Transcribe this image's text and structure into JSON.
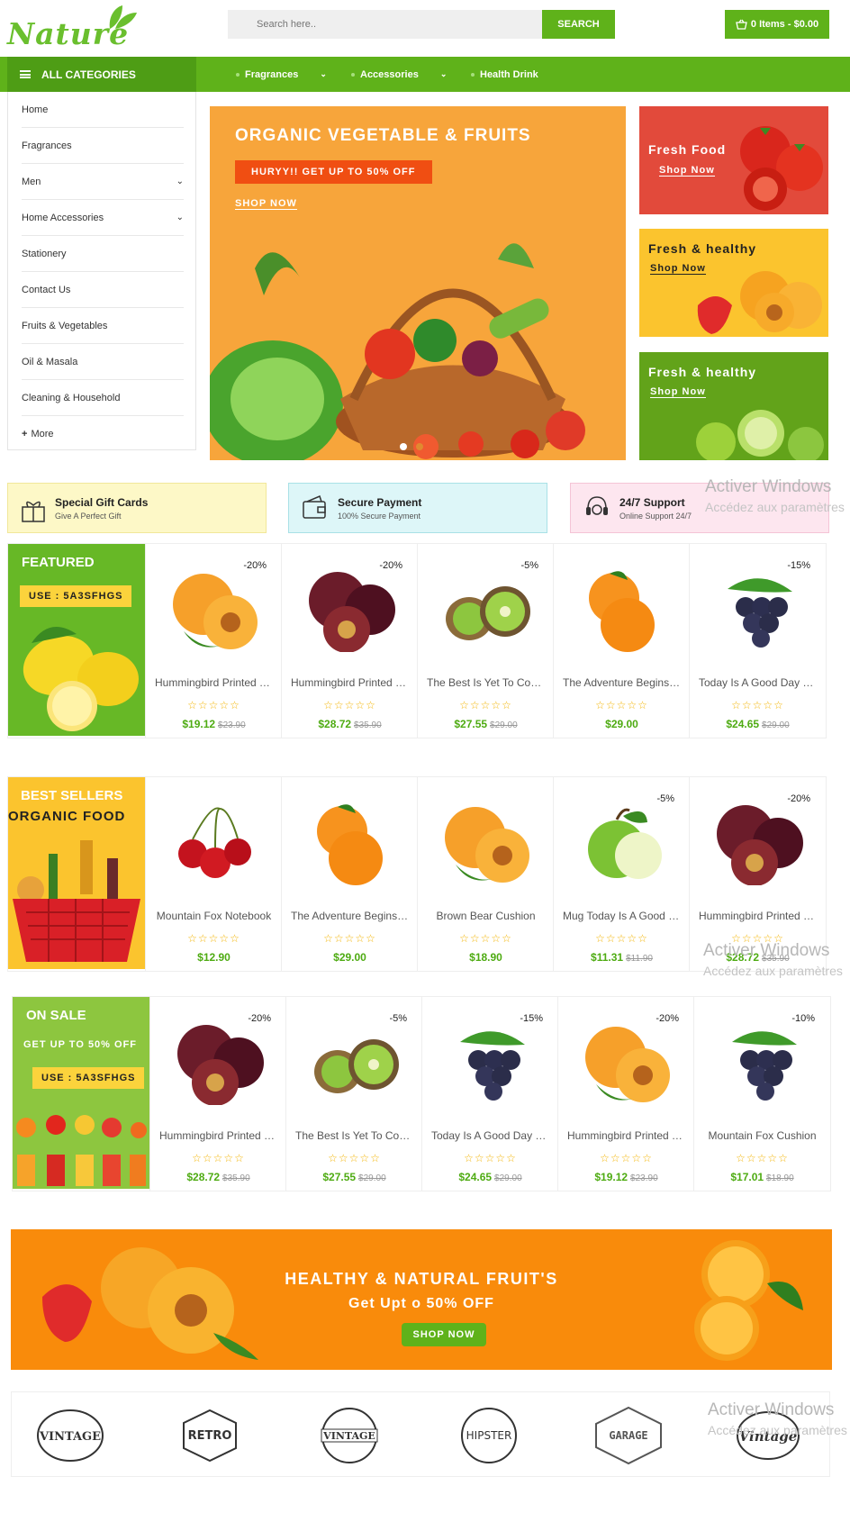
{
  "header": {
    "logo_text": "Nature",
    "search_placeholder": "Search here..",
    "search_button": "SEARCH",
    "cart_label": "0 Items - $0.00"
  },
  "nav": {
    "all_categories": "ALL CATEGORIES",
    "links": [
      "Fragrances",
      "Accessories",
      "Health Drink"
    ]
  },
  "sidebar": {
    "items": [
      "Home",
      "Fragrances",
      "Men",
      "Home Accessories",
      "Stationery",
      "Contact Us",
      "Fruits & Vegetables",
      "Oil & Masala",
      "Cleaning & Household"
    ],
    "more": "More"
  },
  "hero": {
    "title": "ORGANIC VEGETABLE & FRUITS",
    "promo": "HURYY!! GET UP TO 50% OFF",
    "shop": "SHOP NOW"
  },
  "side_banners": [
    {
      "title": "Fresh Food",
      "link": "Shop Now"
    },
    {
      "title": "Fresh & healthy",
      "link": "Shop Now"
    },
    {
      "title": "Fresh & healthy",
      "link": "Shop Now"
    }
  ],
  "services": [
    {
      "title": "Special Gift Cards",
      "sub": "Give A Perfect Gift"
    },
    {
      "title": "Secure Payment",
      "sub": "100% Secure Payment"
    },
    {
      "title": "24/7 Support",
      "sub": "Online Support 24/7"
    }
  ],
  "watermark": {
    "title": "Activer Windows",
    "sub": "Accédez aux paramètres"
  },
  "featured": {
    "title": "FEATURED",
    "code": "USE : 5A3SFHGS",
    "products": [
      {
        "badge": "-20%",
        "name": "Hummingbird Printed T-Shirt",
        "price": "$19.12",
        "old": "$23.90",
        "fruit": "apricot"
      },
      {
        "badge": "-20%",
        "name": "Hummingbird Printed Sweater",
        "price": "$28.72",
        "old": "$35.90",
        "fruit": "plum"
      },
      {
        "badge": "-5%",
        "name": "The Best Is Yet To Come",
        "price": "$27.55",
        "old": "$29.00",
        "fruit": "kiwi"
      },
      {
        "badge": "",
        "name": "The Adventure Begins Framed",
        "price": "$29.00",
        "old": "",
        "fruit": "orange"
      },
      {
        "badge": "-15%",
        "name": "Today Is A Good Day Framed",
        "price": "$24.65",
        "old": "$29.00",
        "fruit": "grape"
      }
    ]
  },
  "bestsellers": {
    "title": "BEST SELLERS",
    "subtitle": "ORGANIC FOOD",
    "products": [
      {
        "badge": "",
        "name": "Mountain Fox Notebook",
        "price": "$12.90",
        "old": "",
        "fruit": "cherry"
      },
      {
        "badge": "",
        "name": "The Adventure Begins Framed",
        "price": "$29.00",
        "old": "",
        "fruit": "orange"
      },
      {
        "badge": "",
        "name": "Brown Bear Cushion",
        "price": "$18.90",
        "old": "",
        "fruit": "apricot"
      },
      {
        "badge": "-5%",
        "name": "Mug Today Is A Good Day",
        "price": "$11.31",
        "old": "$11.90",
        "fruit": "apple"
      },
      {
        "badge": "-20%",
        "name": "Hummingbird Printed Sweater",
        "price": "$28.72",
        "old": "$35.90",
        "fruit": "plum"
      }
    ]
  },
  "onsale": {
    "title": "ON SALE",
    "subtitle": "GET UP TO 50% OFF",
    "code": "USE : 5A3SFHGS",
    "products": [
      {
        "badge": "-20%",
        "name": "Hummingbird Printed Sweater",
        "price": "$28.72",
        "old": "$35.90",
        "fruit": "plum"
      },
      {
        "badge": "-5%",
        "name": "The Best Is Yet To Come",
        "price": "$27.55",
        "old": "$29.00",
        "fruit": "kiwi"
      },
      {
        "badge": "-15%",
        "name": "Today Is A Good Day Framed",
        "price": "$24.65",
        "old": "$29.00",
        "fruit": "grape"
      },
      {
        "badge": "-20%",
        "name": "Hummingbird Printed T-Shirt",
        "price": "$19.12",
        "old": "$23.90",
        "fruit": "apricot"
      },
      {
        "badge": "-10%",
        "name": "Mountain Fox Cushion",
        "price": "$17.01",
        "old": "$18.90",
        "fruit": "grape"
      }
    ]
  },
  "banner": {
    "title": "HEALTHY & NATURAL FRUIT'S",
    "subtitle": "Get Upt o  50% OFF",
    "button": "SHOP NOW"
  },
  "brands": [
    "VINTAGE",
    "RETRO",
    "VINTAGE",
    "HIPSTER",
    "GARAGE",
    "Vintage"
  ],
  "colors": {
    "primary": "#5fb21a",
    "dark_green": "#4e9d15",
    "orange": "#f98b0b",
    "hero": "#f7a53b",
    "red": "#e24a3b",
    "yellow": "#fbc42e"
  }
}
